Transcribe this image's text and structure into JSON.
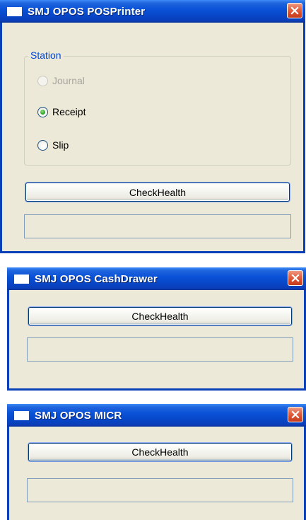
{
  "windows": [
    {
      "title": "SMJ OPOS POSPrinter",
      "station": {
        "legend": "Station",
        "options": [
          {
            "label": "Journal",
            "selected": false,
            "enabled": false
          },
          {
            "label": "Receipt",
            "selected": true,
            "enabled": true
          },
          {
            "label": "Slip",
            "selected": false,
            "enabled": true
          }
        ]
      },
      "button_label": "CheckHealth",
      "status_text": ""
    },
    {
      "title": "SMJ OPOS CashDrawer",
      "button_label": "CheckHealth",
      "status_text": ""
    },
    {
      "title": "SMJ OPOS MICR",
      "button_label": "CheckHealth",
      "status_text": ""
    }
  ],
  "icons": {
    "app": "window-icon",
    "close": "close-icon"
  },
  "colors": {
    "titlebar": "#0a52d8",
    "window_bg": "#ece9d8",
    "close_button": "#d84a2a",
    "group_legend": "#0046d5",
    "radio_selected": "#3aa935"
  }
}
